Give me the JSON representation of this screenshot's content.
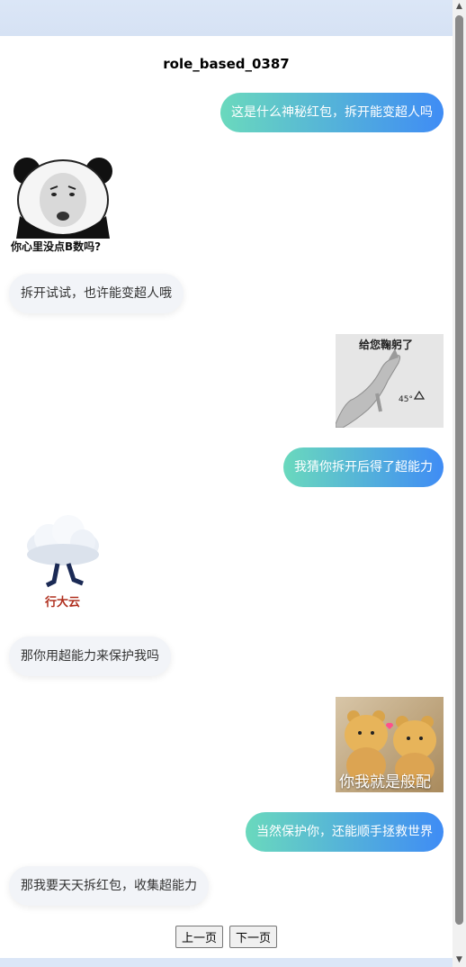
{
  "chat": {
    "title": "role_based_0387",
    "messages": [
      {
        "side": "right",
        "type": "text",
        "text": "这是什么神秘红包，拆开能变超人吗"
      },
      {
        "side": "left",
        "type": "sticker",
        "icon": "panda-face-sticker",
        "caption": "你心里没点B数吗?"
      },
      {
        "side": "left",
        "type": "text",
        "text": "拆开试试，也许能变超人哦"
      },
      {
        "side": "right",
        "type": "sticker",
        "icon": "dog-bowing-sticker",
        "caption": "给您鞠躬了",
        "caption2": "45°"
      },
      {
        "side": "right",
        "type": "text",
        "text": "我猜你拆开后得了超能力"
      },
      {
        "side": "left",
        "type": "sticker",
        "icon": "walking-cloud-sticker",
        "caption": "行大云"
      },
      {
        "side": "left",
        "type": "text",
        "text": "那你用超能力来保护我吗"
      },
      {
        "side": "right",
        "type": "sticker",
        "icon": "two-bears-sticker",
        "caption": "你我就是般配"
      },
      {
        "side": "right",
        "type": "text",
        "text": "当然保护你，还能顺手拯救世界"
      },
      {
        "side": "left",
        "type": "text",
        "text": "那我要天天拆红包，收集超能力"
      }
    ]
  },
  "pager": {
    "prev_label": "上一页",
    "next_label": "下一页"
  },
  "colors": {
    "bubble_right_start": "#6ad9bd",
    "bubble_right_end": "#3f8cf5",
    "bubble_left_bg": "#f2f4f8",
    "header_bg": "#dbe6f7"
  }
}
